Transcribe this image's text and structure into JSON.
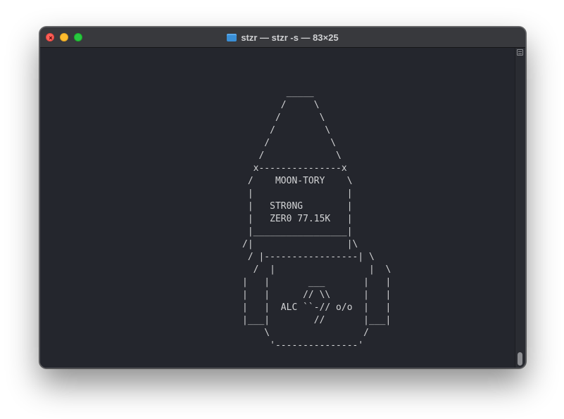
{
  "window": {
    "title": "stzr — stzr -s — 83×25",
    "close_glyph": "×",
    "icons": {
      "folder": "folder-icon",
      "close": "close-icon",
      "minimize": "minimize-icon",
      "maximize": "maximize-icon",
      "scroll": "split-pane-icon"
    }
  },
  "terminal": {
    "art": "         _____\n        /     \\\n       /       \\\n      /         \\\n     /           \\\n    /             \\\n   x---------------x\n  /    MOON-TORY    \\\n  |                 |\n  |   STR0NG        |\n  |   ZER0 77.15K   |\n  |_________________|\n /|                 |\\\n/ |-----------------| \\\n  |       ___       |\n|  |      // \\\\     |  |\n|  |  ALC ``-// o/o  |  |\n|___|       //       |___|\n  \\                 /\n   '---------------'",
    "lines": [
      "        _____",
      "       /     \\",
      "      /       \\",
      "     /         \\",
      "    /           \\",
      "   /             \\",
      "  x---------------x",
      " /    MOON-TORY    \\",
      " |                 |",
      " |   STR0NG        |",
      " |   ZER0 77.15K   |",
      " |_________________|",
      "/|                 |\\",
      " / |-----------------| \\",
      "  /  |                 |  \\",
      "|   |       ___       |   |",
      "|   |      // \\\\      |   |",
      "|   |  ALC ``-// o/o  |   |",
      "|___|        //       |___|",
      "    \\                 /",
      "     '---------------'"
    ]
  },
  "colors": {
    "background": "#24262d",
    "text": "#d3d4d6",
    "titlebar": "#38393d",
    "close": "#fe5f57",
    "minimize": "#febc2e",
    "maximize": "#28c840"
  }
}
